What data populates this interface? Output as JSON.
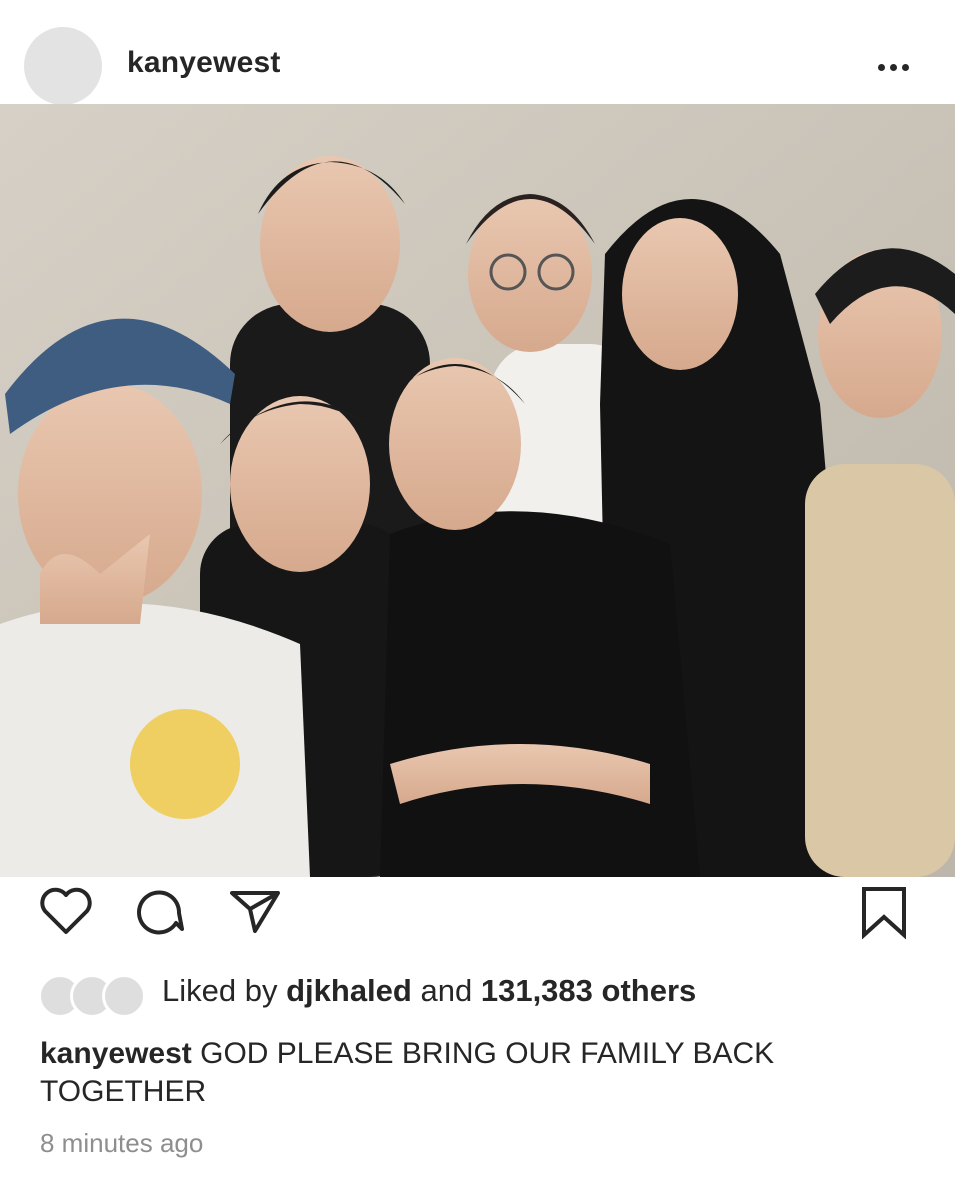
{
  "post": {
    "username": "kanyewest",
    "more_icon": "more-horizontal-icon",
    "photo": {
      "subject_count": 7
    },
    "actions": {
      "like_icon": "heart-icon",
      "comment_icon": "comment-icon",
      "share_icon": "paper-plane-icon",
      "save_icon": "bookmark-icon"
    },
    "likes": {
      "prefix": "Liked by",
      "user": "djkhaled",
      "middle": "and",
      "count": "131,383 others"
    },
    "caption": {
      "username": "kanyewest",
      "text": "GOD PLEASE BRING OUR FAMILY BACK TOGETHER"
    },
    "timestamp": "8 minutes ago"
  }
}
